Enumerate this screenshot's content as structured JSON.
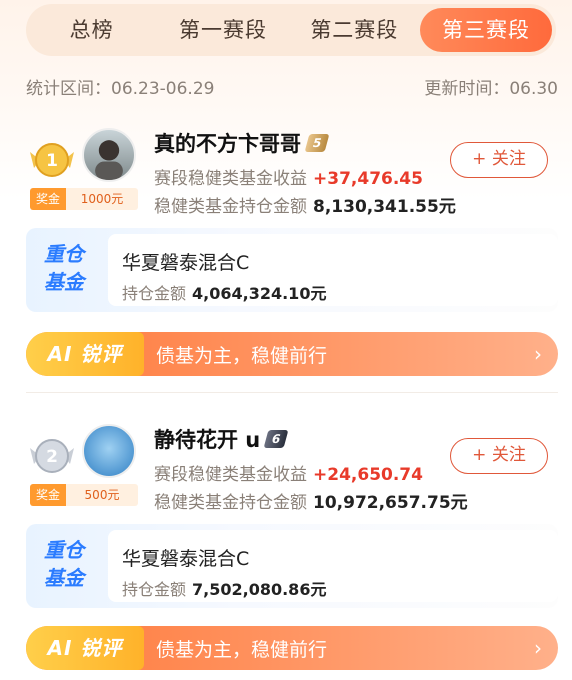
{
  "tabs": [
    "总榜",
    "第一赛段",
    "第二赛段",
    "第三赛段"
  ],
  "stats": {
    "range": "统计区间：06.23-06.29",
    "updated": "更新时间：06.30"
  },
  "entries": [
    {
      "rank": "1",
      "name": "真的不方卞哥哥",
      "level": "5",
      "reward_label": "奖金",
      "reward_value": "1000元",
      "income_label": "赛段稳健类基金收益",
      "income_value": "+37,476.45",
      "holding_label": "稳健类基金持仓金额",
      "holding_value": "8,130,341.55元",
      "follow": "+ 关注",
      "heavy_tag": "重仓基金",
      "fund_name": "华夏磐泰混合C",
      "fund_amount_label": "持仓金额",
      "fund_amount_value": "4,064,324.10元",
      "ai_badge": "AI 锐评",
      "ai_text": "债基为主，稳健前行",
      "arrow": "›"
    },
    {
      "rank": "2",
      "name": "静待花开 u",
      "level": "6",
      "reward_label": "奖金",
      "reward_value": "500元",
      "income_label": "赛段稳健类基金收益",
      "income_value": "+24,650.74",
      "holding_label": "稳健类基金持仓金额",
      "holding_value": "10,972,657.75元",
      "follow": "+ 关注",
      "heavy_tag": "重仓基金",
      "fund_name": "华夏磐泰混合C",
      "fund_amount_label": "持仓金额",
      "fund_amount_value": "7,502,080.86元",
      "ai_badge": "AI 锐评",
      "ai_text": "债基为主，稳健前行",
      "arrow": "›"
    }
  ],
  "colors": {
    "accent": "#ff6a3c",
    "gain": "#e83a2a",
    "tag_blue": "#2b7cff",
    "gold": "#ffb22a"
  }
}
